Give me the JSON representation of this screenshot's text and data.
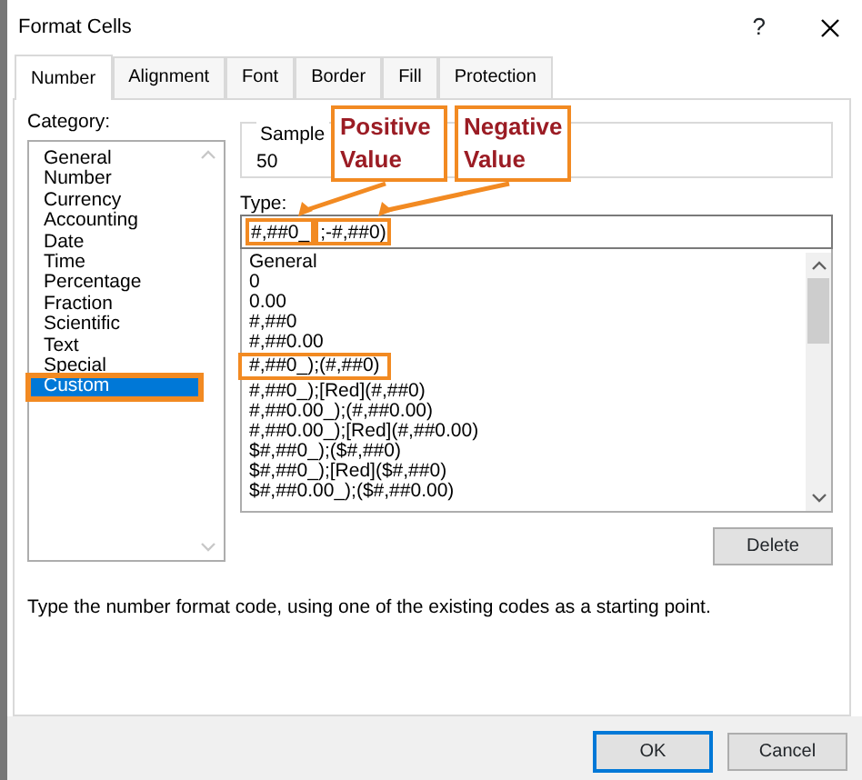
{
  "window": {
    "title": "Format Cells",
    "help": "?"
  },
  "tabs": [
    {
      "label": "Number",
      "selected": true
    },
    {
      "label": "Alignment",
      "selected": false
    },
    {
      "label": "Font",
      "selected": false
    },
    {
      "label": "Border",
      "selected": false
    },
    {
      "label": "Fill",
      "selected": false
    },
    {
      "label": "Protection",
      "selected": false
    }
  ],
  "category": {
    "label": "Category:",
    "items": [
      {
        "label": "General",
        "selected": false,
        "highlighted": false
      },
      {
        "label": "Number",
        "selected": false,
        "highlighted": false
      },
      {
        "label": "Currency",
        "selected": false,
        "highlighted": false
      },
      {
        "label": "Accounting",
        "selected": false,
        "highlighted": false
      },
      {
        "label": "Date",
        "selected": false,
        "highlighted": false
      },
      {
        "label": "Time",
        "selected": false,
        "highlighted": false
      },
      {
        "label": "Percentage",
        "selected": false,
        "highlighted": false
      },
      {
        "label": "Fraction",
        "selected": false,
        "highlighted": false
      },
      {
        "label": "Scientific",
        "selected": false,
        "highlighted": false
      },
      {
        "label": "Text",
        "selected": false,
        "highlighted": false
      },
      {
        "label": "Special",
        "selected": false,
        "highlighted": false
      },
      {
        "label": "Custom",
        "selected": true,
        "highlighted": true
      }
    ]
  },
  "sample": {
    "label": "Sample",
    "value": "50"
  },
  "type": {
    "label": "Type:",
    "value_parts": [
      "#,##0_",
      ";-#,##0)"
    ]
  },
  "formats": [
    {
      "label": "General",
      "highlighted": false
    },
    {
      "label": "0",
      "highlighted": false
    },
    {
      "label": "0.00",
      "highlighted": false
    },
    {
      "label": "#,##0",
      "highlighted": false
    },
    {
      "label": "#,##0.00",
      "highlighted": false
    },
    {
      "label": "#,##0_);(#,##0)",
      "highlighted": true
    },
    {
      "label": "#,##0_);[Red](#,##0)",
      "highlighted": false
    },
    {
      "label": "#,##0.00_);(#,##0.00)",
      "highlighted": false
    },
    {
      "label": "#,##0.00_);[Red](#,##0.00)",
      "highlighted": false
    },
    {
      "label": "$#,##0_);($#,##0)",
      "highlighted": false
    },
    {
      "label": "$#,##0_);[Red]($#,##0)",
      "highlighted": false
    },
    {
      "label": "$#,##0.00_);($#,##0.00)",
      "highlighted": false
    }
  ],
  "delete_button": "Delete",
  "description": "Type the number format code, using one of the existing codes as a starting point.",
  "buttons": [
    {
      "label": "OK",
      "default": true
    },
    {
      "label": "Cancel",
      "default": false
    }
  ],
  "annotations": [
    {
      "text": "Positive Value"
    },
    {
      "text": "Negative Value"
    }
  ]
}
